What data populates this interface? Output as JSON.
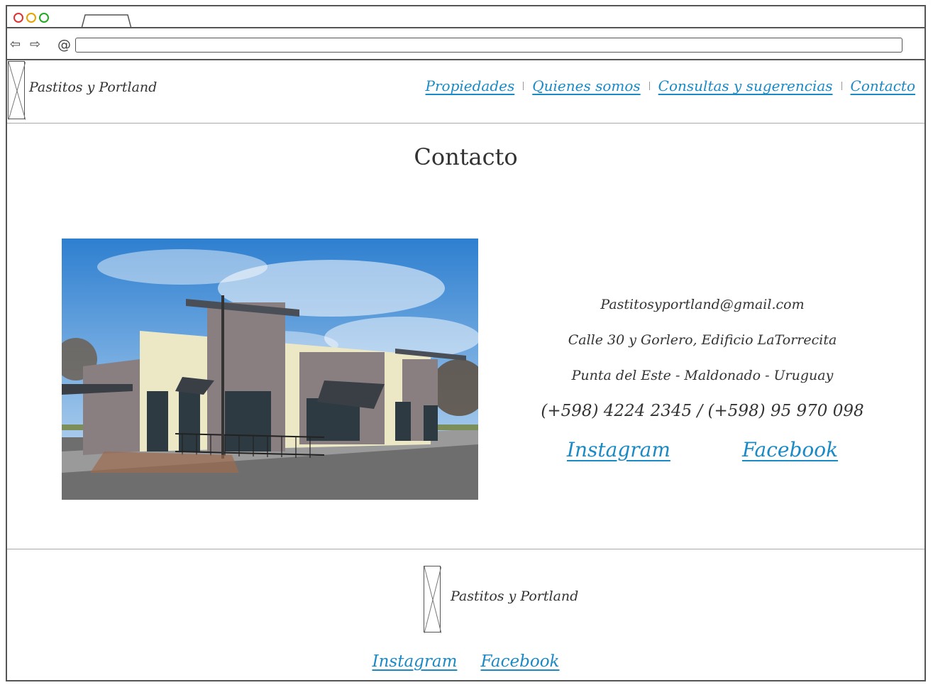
{
  "browser": {
    "window_controls": {
      "close_color": "#dd3333",
      "minimize_color": "#e8a200",
      "maximize_color": "#22aa22"
    },
    "nav_icons": {
      "back": "back-arrow-icon",
      "forward": "forward-arrow-icon",
      "reload": "reload-icon"
    },
    "url_value": ""
  },
  "header": {
    "brand": "Pastitos y Portland",
    "nav": [
      {
        "label": "Propiedades"
      },
      {
        "label": "Quienes somos"
      },
      {
        "label": "Consultas y sugerencias"
      },
      {
        "label": "Contacto"
      }
    ],
    "link_color": "#1a8ac6"
  },
  "main": {
    "title": "Contacto",
    "image": "storefront-building-photo",
    "contact": {
      "email": "Pastitosyportland@gmail.com",
      "address": "Calle 30 y Gorlero, Edificio LaTorrecita",
      "city": "Punta del Este - Maldonado - Uruguay",
      "phones": "(+598) 4224 2345 / (+598) 95 970 098"
    },
    "social": {
      "instagram": "Instagram",
      "facebook": "Facebook"
    }
  },
  "footer": {
    "brand": "Pastitos y Portland",
    "social": {
      "instagram": "Instagram",
      "facebook": "Facebook"
    }
  }
}
